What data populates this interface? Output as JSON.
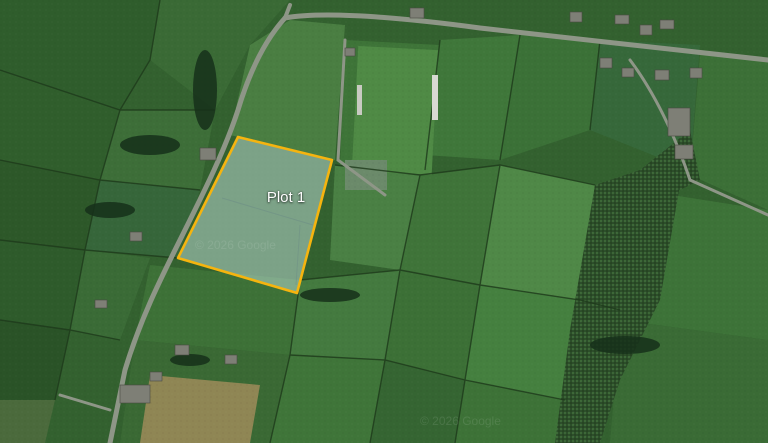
{
  "map": {
    "view": "satellite",
    "plot": {
      "label": "Plot 1",
      "outline_color": "#f5b40f",
      "fill_color": "#b8d8d0"
    },
    "watermarks": [
      "© 2026 Google",
      "© 2026 Google"
    ]
  }
}
